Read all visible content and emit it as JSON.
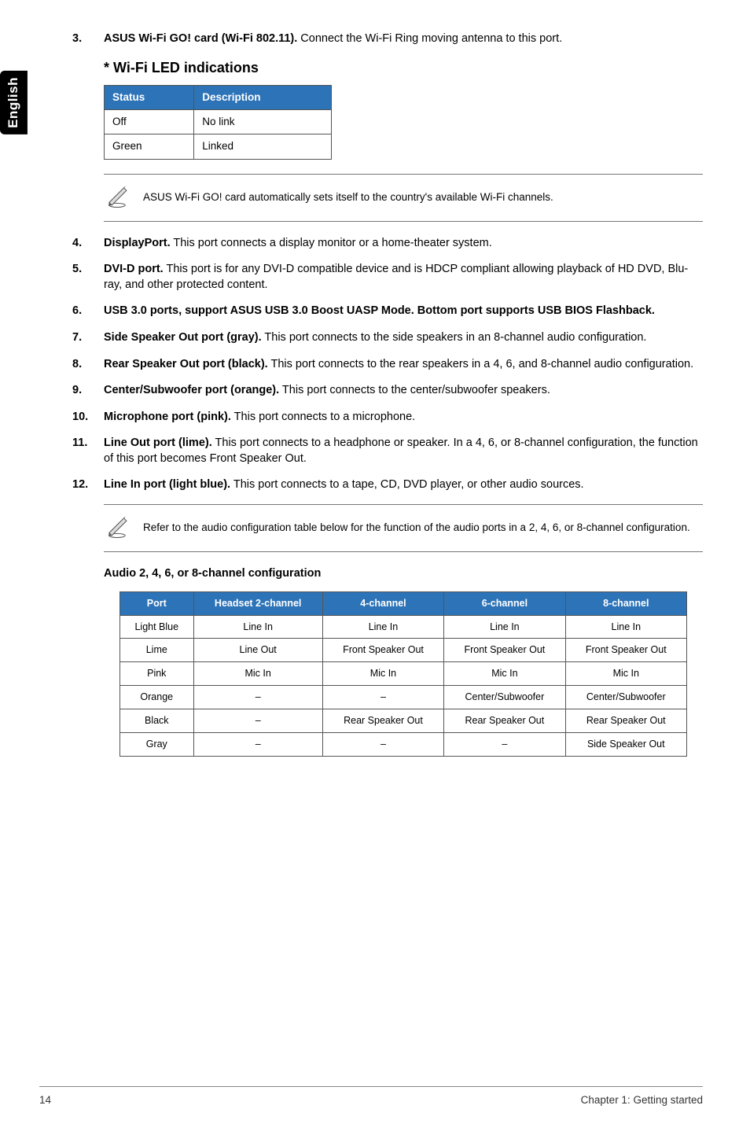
{
  "side_tab": "English",
  "item3": {
    "num": "3.",
    "label": "ASUS Wi-Fi GO! card (Wi-Fi 802.11).",
    "text": " Connect the Wi-Fi Ring moving antenna to this port."
  },
  "wifi_heading": "* Wi-Fi LED indications",
  "wifi_led": {
    "headers": [
      "Status",
      "Description"
    ],
    "rows": [
      [
        "Off",
        "No link"
      ],
      [
        "Green",
        "Linked"
      ]
    ]
  },
  "note1": "ASUS Wi-Fi GO! card automatically sets itself to the country's available Wi-Fi channels.",
  "items": [
    {
      "num": "4.",
      "label": "DisplayPort.",
      "text": " This port connects a display monitor or a home-theater system."
    },
    {
      "num": "5.",
      "label": "DVI-D port.",
      "text": " This port is for any DVI-D compatible device and is HDCP compliant allowing playback of HD DVD, Blu-ray, and other protected content."
    },
    {
      "num": "6.",
      "label": "USB 3.0 ports, support ASUS USB 3.0 Boost UASP Mode. Bottom port supports USB BIOS Flashback.",
      "text": ""
    },
    {
      "num": "7.",
      "label": "Side Speaker Out port (gray).",
      "text": " This port connects to the side speakers in an 8-channel audio configuration."
    },
    {
      "num": "8.",
      "label": "Rear Speaker Out port (black).",
      "text": " This port connects to the rear speakers in a 4, 6, and 8-channel audio configuration."
    },
    {
      "num": "9.",
      "label": "Center/Subwoofer port (orange).",
      "text": " This port connects to the center/subwoofer speakers."
    },
    {
      "num": "10.",
      "label": "Microphone port (pink).",
      "text": " This port connects to a microphone."
    },
    {
      "num": "11.",
      "label": "Line Out port (lime).",
      "text": " This port connects to a headphone or speaker. In a 4, 6, or 8-channel configuration, the function of this port becomes Front Speaker Out."
    },
    {
      "num": "12.",
      "label": "Line In port (light blue).",
      "text": " This port connects to a tape, CD, DVD player, or other audio sources."
    }
  ],
  "note2": "Refer to the audio configuration table below for the function of the audio ports in a 2, 4, 6, or 8-channel configuration.",
  "audio_heading": "Audio 2, 4, 6, or 8-channel configuration",
  "audio_table": {
    "headers": [
      "Port",
      "Headset 2-channel",
      "4-channel",
      "6-channel",
      "8-channel"
    ],
    "rows": [
      [
        "Light Blue",
        "Line In",
        "Line In",
        "Line In",
        "Line In"
      ],
      [
        "Lime",
        "Line Out",
        "Front Speaker Out",
        "Front Speaker Out",
        "Front Speaker Out"
      ],
      [
        "Pink",
        "Mic In",
        "Mic In",
        "Mic In",
        "Mic In"
      ],
      [
        "Orange",
        "–",
        "–",
        "Center/Subwoofer",
        "Center/Subwoofer"
      ],
      [
        "Black",
        "–",
        "Rear Speaker Out",
        "Rear Speaker Out",
        "Rear Speaker Out"
      ],
      [
        "Gray",
        "–",
        "–",
        "–",
        "Side Speaker Out"
      ]
    ]
  },
  "footer": {
    "page": "14",
    "chapter": "Chapter 1: Getting started"
  }
}
